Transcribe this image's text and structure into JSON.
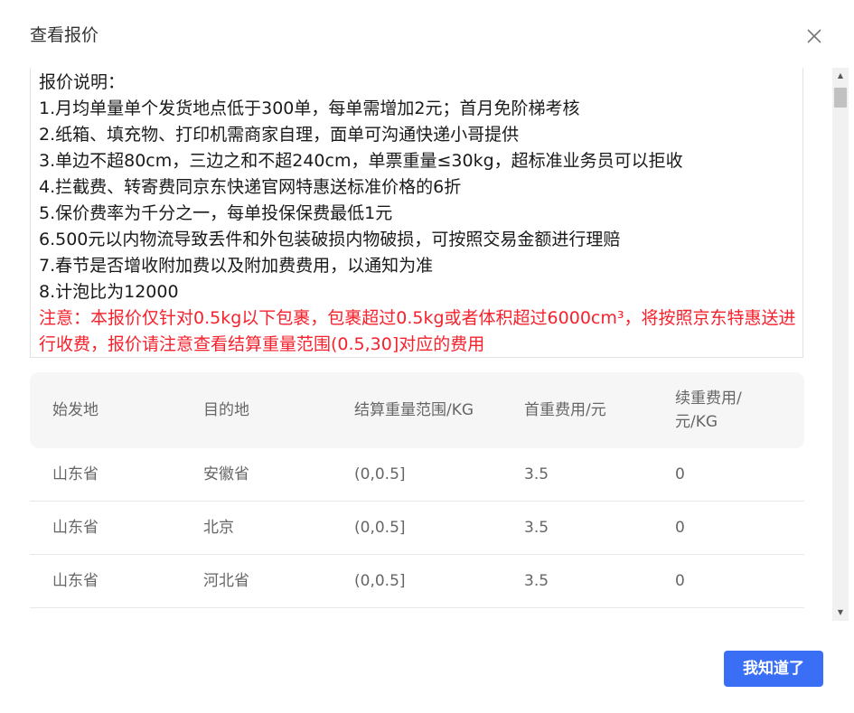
{
  "dialog": {
    "title": "查看报价",
    "close_icon": "close-icon",
    "ok_label": "我知道了"
  },
  "notes": {
    "heading": "报价说明：",
    "items": [
      "1.月均单量单个发货地点低于300单，每单需增加2元；首月免阶梯考核",
      "2.纸箱、填充物、打印机需商家自理，面单可沟通快递小哥提供",
      "3.单边不超80cm，三边之和不超240cm，单票重量≤30kg，超标准业务员可以拒收",
      "4.拦截费、转寄费同京东快递官网特惠送标准价格的6折",
      "5.保价费率为千分之一，每单投保保费最低1元",
      "6.500元以内物流导致丢件和外包装破损内物破损，可按照交易金额进行理赔",
      "7.春节是否增收附加费以及附加费费用，以通知为准",
      "8.计泡比为12000"
    ],
    "warning": "注意：本报价仅针对0.5kg以下包裹，包裹超过0.5kg或者体积超过6000cm³，将按照京东特惠送进行收费，报价请注意查看结算重量范围(0.5,30]对应的费用",
    "warning_color": "#f5222d"
  },
  "table": {
    "headers": [
      "始发地",
      "目的地",
      "结算重量范围/KG",
      "首重费用/元",
      "续重费用/",
      "元/KG"
    ],
    "rows": [
      [
        "山东省",
        "安徽省",
        "(0,0.5]",
        "3.5",
        "0"
      ],
      [
        "山东省",
        "北京",
        "(0,0.5]",
        "3.5",
        "0"
      ],
      [
        "山东省",
        "河北省",
        "(0,0.5]",
        "3.5",
        "0"
      ]
    ]
  },
  "colors": {
    "primary": "#3a6ff5",
    "warning": "#f5222d"
  }
}
